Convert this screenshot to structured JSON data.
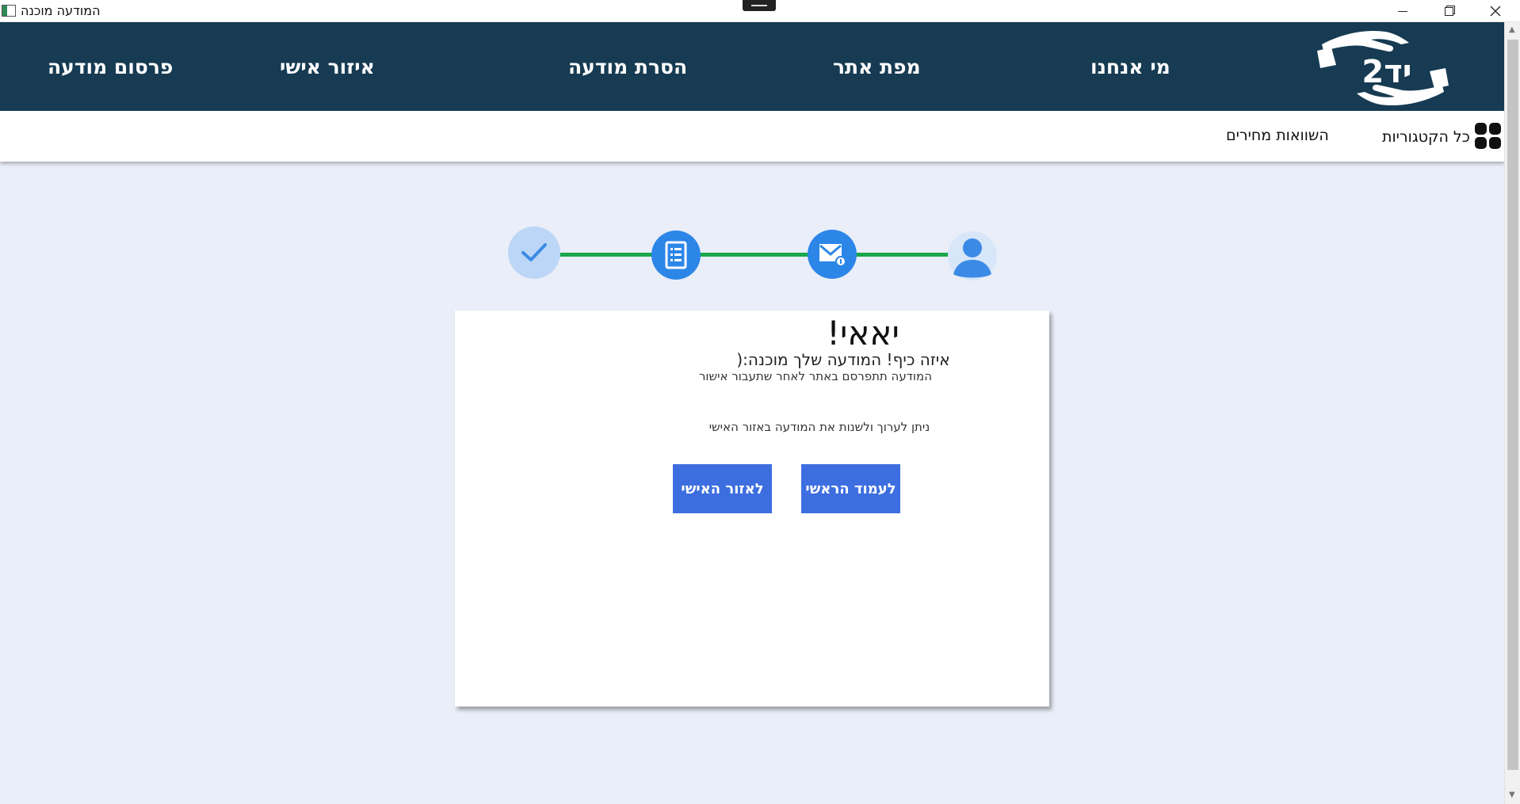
{
  "window": {
    "title": "המודעה מוכנה"
  },
  "nav": {
    "about": "מי אנחנו",
    "sitemap": "מפת אתר",
    "remove_ad": "הסרת מודעה",
    "personal_area": "איזור אישי",
    "publish_ad": "פרסום מודעה",
    "logo_text": "יד2"
  },
  "subnav": {
    "all_categories": "כל הקטגוריות",
    "price_compare": "השוואות מחירים"
  },
  "stepper": {
    "steps": [
      {
        "icon": "user-icon",
        "state": "done"
      },
      {
        "icon": "mail-icon",
        "state": "done"
      },
      {
        "icon": "list-icon",
        "state": "done"
      },
      {
        "icon": "check-icon",
        "state": "current"
      }
    ],
    "colors": {
      "line": "#1aa64a",
      "done": "#2c86e8",
      "current": "#bcd6f7",
      "check": "#3b8ae6"
    }
  },
  "card": {
    "headline": "יאאי!",
    "subline": "איזה כיף! המודעה שלך מוכנה:(",
    "note_publish": "המודעה תתפרסם באתר לאחר שתעבור אישור",
    "note_edit": "ניתן לערוך ולשנות את המודעה באזור האישי",
    "btn_home": "לעמוד הראשי",
    "btn_personal": "לאזור האישי"
  },
  "colors": {
    "navbar": "#163b52",
    "page_bg": "#eaeef8",
    "button": "#3d6ee0"
  }
}
